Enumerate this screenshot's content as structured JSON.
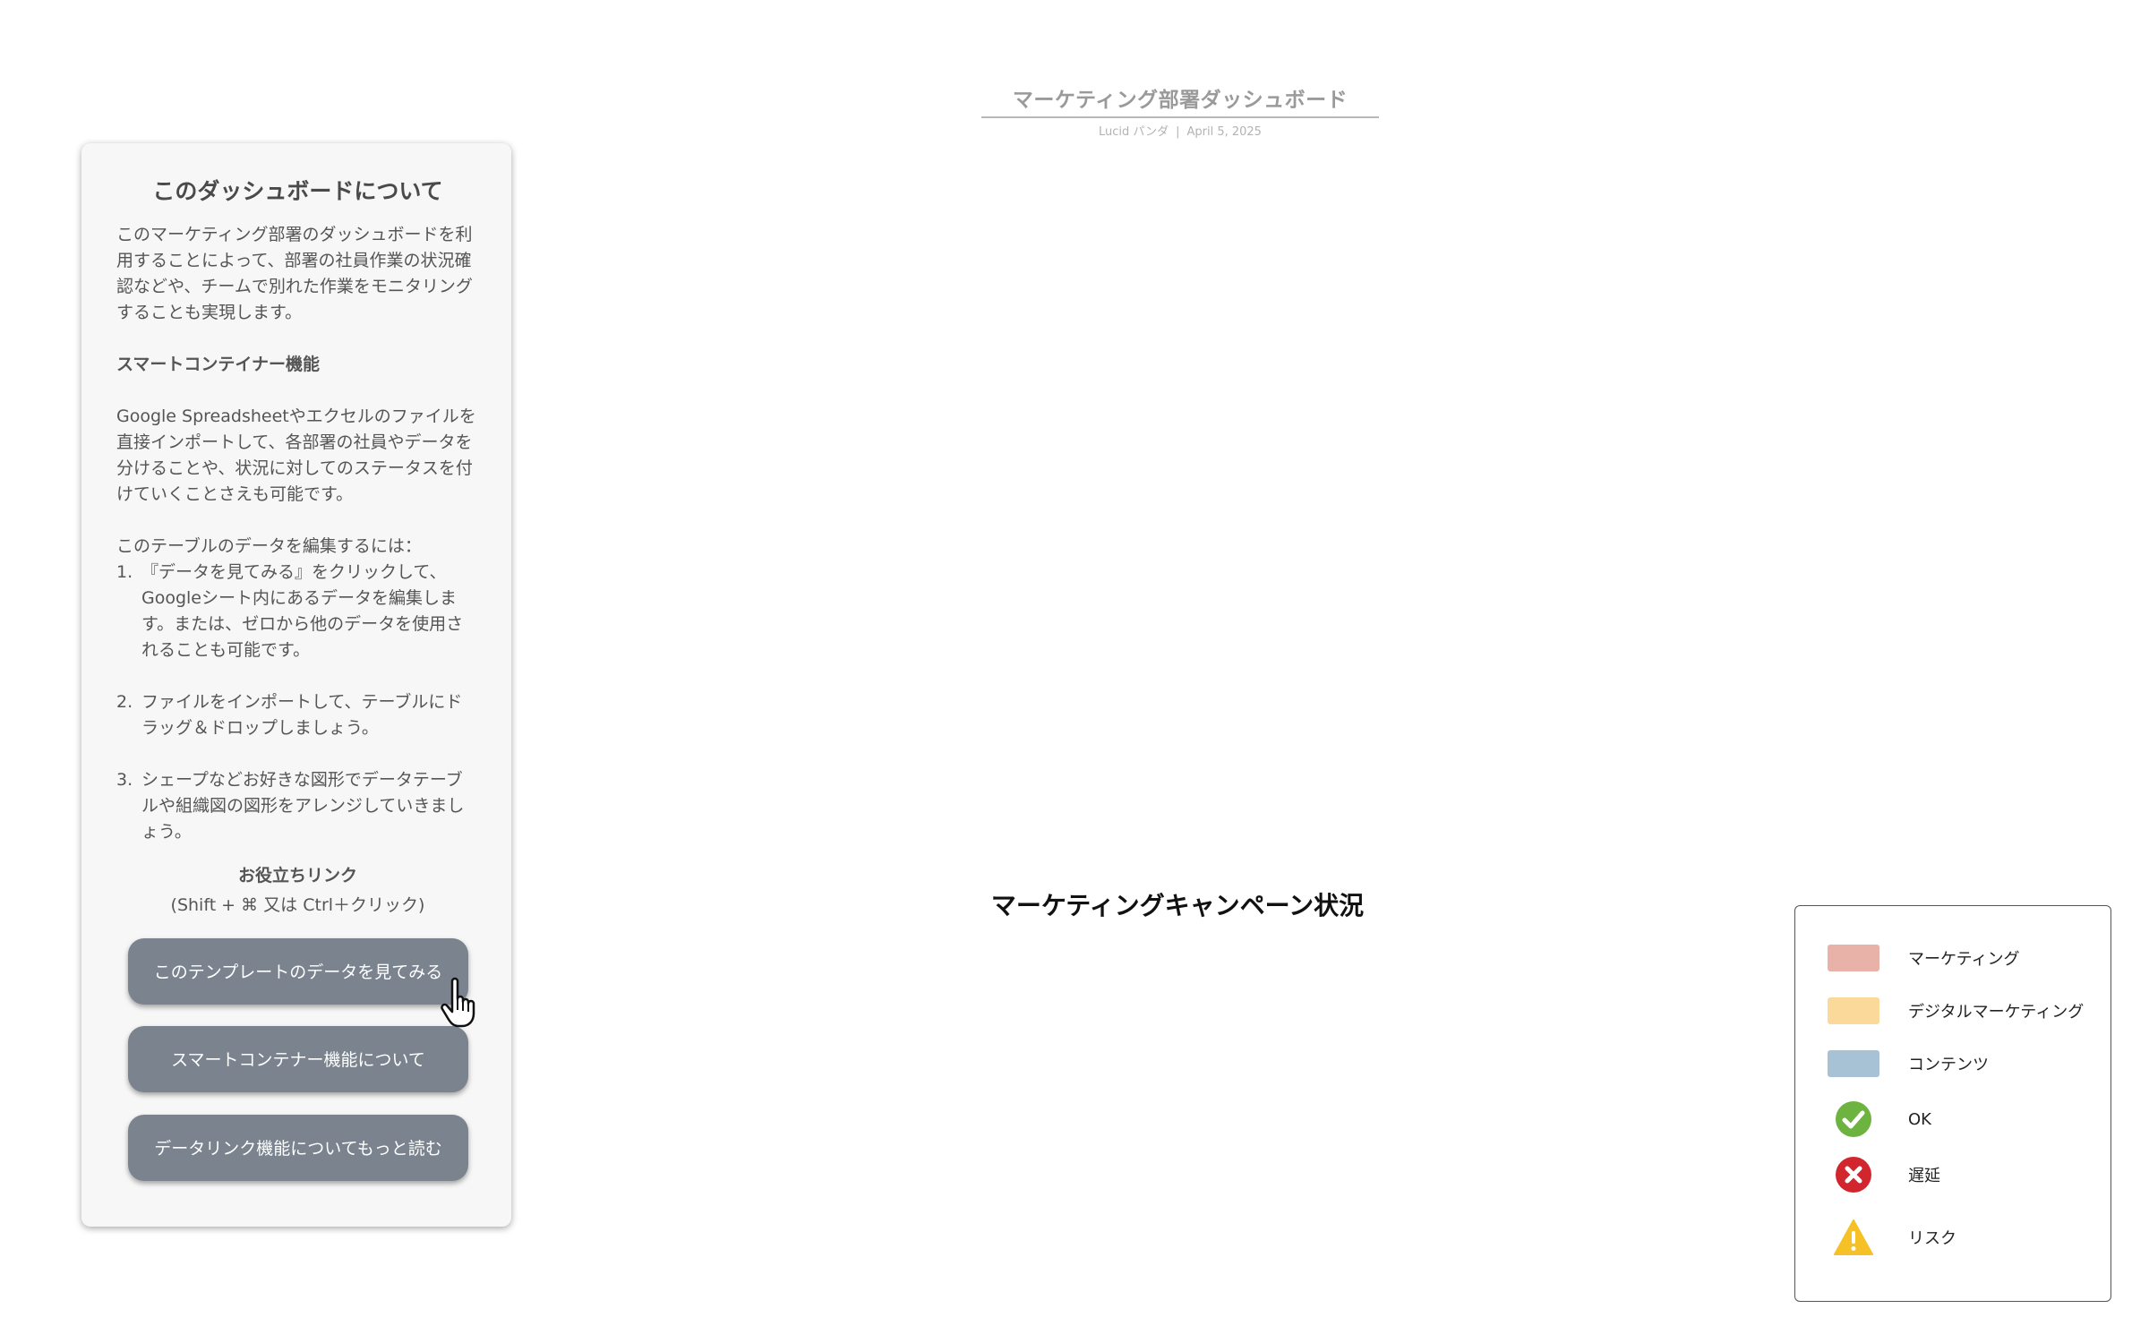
{
  "header": {
    "title": "マーケティング部署ダッシュボード",
    "author": "Lucid パンダ",
    "separator": "|",
    "date": "April 5, 2025"
  },
  "info_panel": {
    "title": "このダッシュボードについて",
    "intro": "このマーケティング部署のダッシュボードを利用することによって、部署の社員作業の状況確認などや、チームで別れた作業をモニタリングすることも実現します。",
    "smart_heading": "スマートコンテイナー機能",
    "smart_text": "Google Spreadsheetやエクセルのファイルを直接インポートして、各部署の社員やデータを分けることや、状況に対してのステータスを付けていくことさえも可能です。",
    "edit_intro": "このテーブルのデータを編集するには：",
    "steps": [
      {
        "num": "1.",
        "text": "『データを見てみる』をクリックして、Googleシート内にあるデータを編集します。または、ゼロから他のデータを使用されることも可能です。"
      },
      {
        "num": "2.",
        "text": "ファイルをインポートして、テーブルにドラッグ＆ドロップしましょう。"
      },
      {
        "num": "3.",
        "text": "シェープなどお好きな図形でデータテーブルや組織図の図形をアレンジしていきましょう。"
      }
    ],
    "links_title": "お役立ちリンク",
    "links_hint": "(Shift + ⌘ 又は Ctrl＋クリック)",
    "buttons": {
      "view_data": "このテンプレートのデータを見てみる",
      "smart_container": "スマートコンテナー機能について",
      "data_link": "データリンク機能についてもっと読む"
    }
  },
  "section": {
    "title": "マーケティングキャンペーン状況"
  },
  "legend": {
    "items": [
      {
        "label": "マーケティング",
        "color": "#e8b2a8"
      },
      {
        "label": "デジタルマーケティング",
        "color": "#fbd99a"
      },
      {
        "label": "コンテンツ",
        "color": "#a6c2d4"
      },
      {
        "label": "OK",
        "icon": "check-circle-icon",
        "color": "#6db33f"
      },
      {
        "label": "遅延",
        "icon": "x-circle-icon",
        "color": "#d2262f"
      },
      {
        "label": "リスク",
        "icon": "warning-triangle-icon",
        "color": "#f5c127"
      }
    ]
  }
}
